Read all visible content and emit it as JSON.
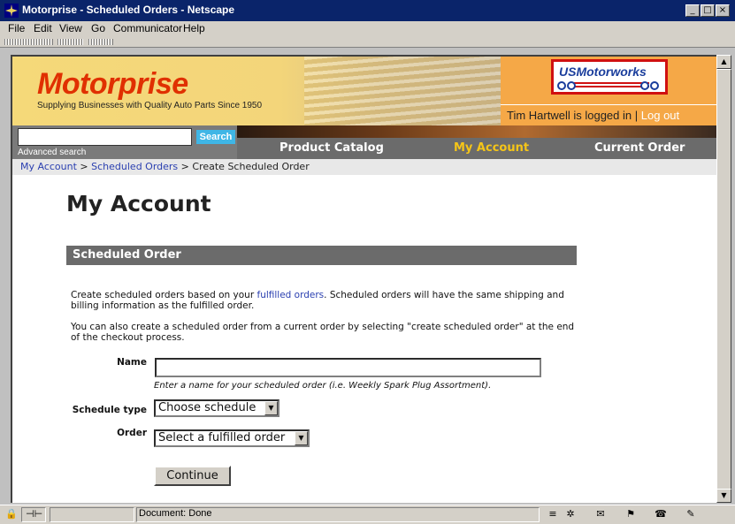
{
  "window": {
    "title": "Motorprise - Scheduled Orders - Netscape"
  },
  "menu": [
    "File",
    "Edit",
    "View",
    "Go",
    "Communicator",
    "Help"
  ],
  "header": {
    "logo": "Motorprise",
    "tagline": "Supplying Businesses with Quality Auto Parts Since 1950",
    "partner_logo": "USMotorworks",
    "user_text": "Tim Hartwell is logged in",
    "separator": "|",
    "logout": "Log out"
  },
  "search": {
    "button": "Search",
    "advanced": "Advanced search",
    "value": ""
  },
  "nav": {
    "catalog": "Product Catalog",
    "account": "My Account",
    "order": "Current Order"
  },
  "breadcrumb": {
    "item1": "My Account",
    "item2": "Scheduled Orders",
    "current": "Create Scheduled Order",
    "sep": ">"
  },
  "main": {
    "title": "My Account",
    "section": "Scheduled Order",
    "para1_a": "Create scheduled orders based on your ",
    "para1_link": "fulfilled orders",
    "para1_b": ". Scheduled orders will have the same shipping and billing information as the fulfilled order.",
    "para2": "You can also create a scheduled order from a current order by selecting \"create scheduled order\" at the end of the checkout process.",
    "name_label": "Name",
    "name_value": "",
    "name_hint": "Enter a name for your scheduled order (i.e. Weekly Spark Plug Assortment).",
    "schedule_label": "Schedule type",
    "schedule_value": "Choose schedule",
    "order_label": "Order",
    "order_value": "Select a fulfilled order",
    "continue": "Continue"
  },
  "status": {
    "text": "Document: Done"
  }
}
